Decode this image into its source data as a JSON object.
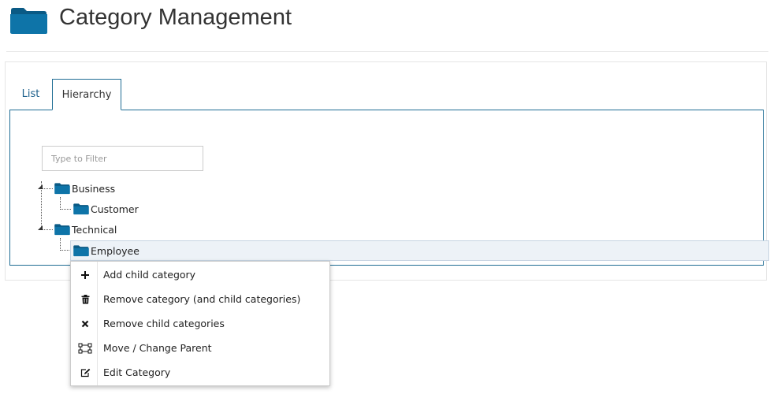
{
  "header": {
    "title": "Category Management",
    "icon": "folder-icon",
    "icon_color": "#0e6e9e"
  },
  "tabs": [
    {
      "label": "List",
      "active": false
    },
    {
      "label": "Hierarchy",
      "active": true
    }
  ],
  "filter": {
    "placeholder": "Type to Filter",
    "value": ""
  },
  "tree": [
    {
      "label": "Business",
      "expanded": true,
      "children": [
        {
          "label": "Customer"
        }
      ]
    },
    {
      "label": "Technical",
      "expanded": true,
      "children": [
        {
          "label": "Employee",
          "selected": true
        }
      ]
    }
  ],
  "context_menu": {
    "items": [
      {
        "label": "Add child category",
        "icon": "plus-icon"
      },
      {
        "label": "Remove category (and child categories)",
        "icon": "trash-icon"
      },
      {
        "label": "Remove child categories",
        "icon": "x-icon"
      },
      {
        "label": "Move / Change Parent",
        "icon": "move-icon"
      },
      {
        "label": "Edit Category",
        "icon": "edit-icon"
      }
    ]
  },
  "colors": {
    "accent": "#1f6d94",
    "folder": "#0e6e9e",
    "selection_bg": "#edf2f7"
  }
}
